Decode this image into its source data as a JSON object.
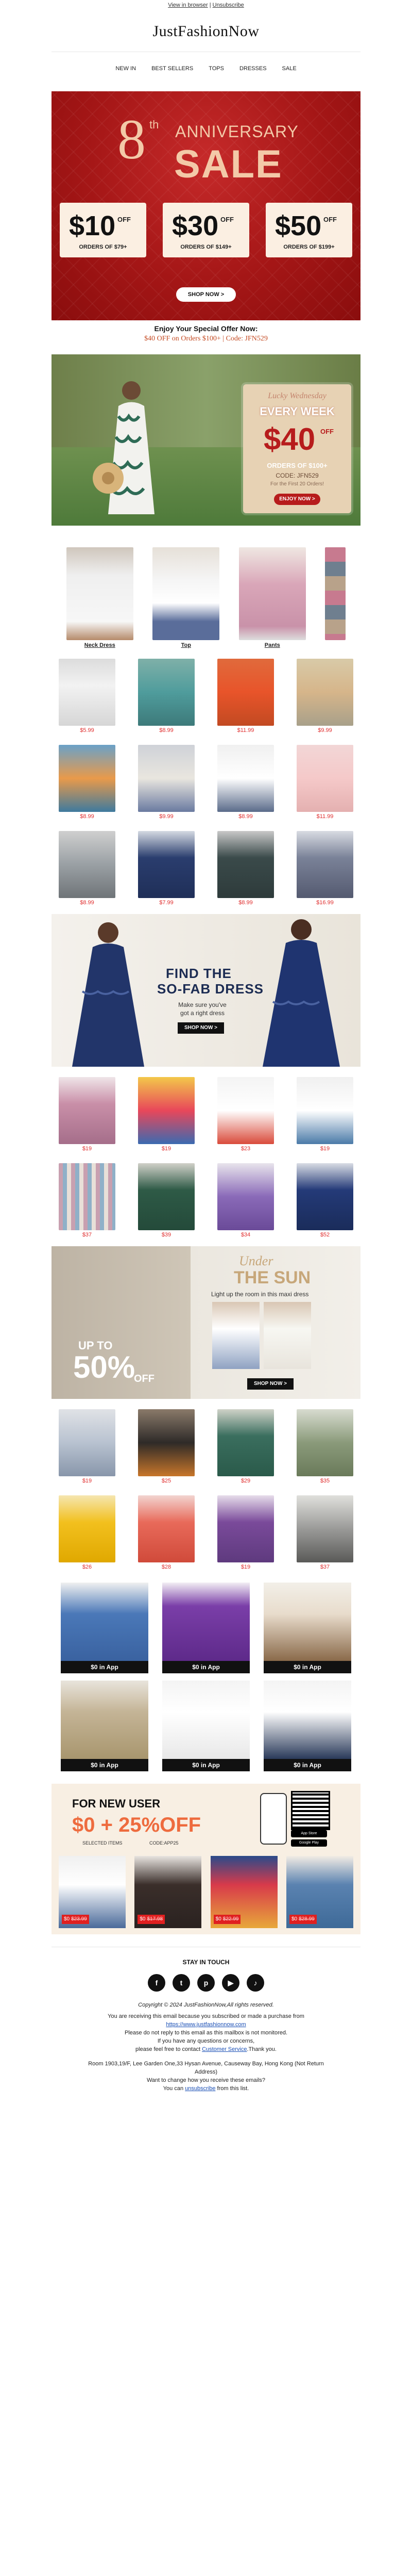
{
  "header": {
    "view_in_browser": "View in browser",
    "sep": " | ",
    "unsubscribe": "Unsubscribe",
    "brand": "JustFashionNow"
  },
  "nav": [
    "NEW IN",
    "BEST SELLERS",
    "TOPS",
    "DRESSES",
    "SALE"
  ],
  "hero": {
    "number": "8",
    "sup": "th",
    "anniversary": "ANNIVERSARY",
    "sale": "SALE",
    "tickets": [
      {
        "amount": "$10",
        "off": "OFF",
        "orders": "ORDERS OF $79+"
      },
      {
        "amount": "$30",
        "off": "OFF",
        "orders": "ORDERS OF $149+"
      },
      {
        "amount": "$50",
        "off": "OFF",
        "orders": "ORDERS OF $199+"
      }
    ],
    "shop_now": "SHOP NOW >",
    "colors": {
      "bg": "#a41616",
      "text": "#f3c9a8"
    }
  },
  "offer": {
    "line1": "Enjoy Your Special Offer Now:",
    "line2": "$40 OFF on Orders $100+ | Code: JFN529"
  },
  "promo": {
    "lucky": "Lucky Wednesday",
    "every_week": "EVERY WEEK",
    "amount": "$40",
    "off": "OFF",
    "orders": "ORDERS OF $100+",
    "code": "CODE: JFN529",
    "first": "For the First 20 Orders!",
    "button": "ENJOY NOW >"
  },
  "categories": [
    {
      "label": "Neck Dress"
    },
    {
      "label": "Top"
    },
    {
      "label": "Pants"
    }
  ],
  "products_a": [
    {
      "price": "$5.99"
    },
    {
      "price": "$8.99"
    },
    {
      "price": "$11.99"
    },
    {
      "price": "$9.99"
    },
    {
      "price": "$8.99"
    },
    {
      "price": "$9.99"
    },
    {
      "price": "$8.99"
    },
    {
      "price": "$11.99"
    },
    {
      "price": "$8.99"
    },
    {
      "price": "$7.99"
    },
    {
      "price": "$8.99"
    },
    {
      "price": "$16.99"
    }
  ],
  "banner1": {
    "line1": "FIND THE",
    "line2": "SO-FAB DRESS",
    "sub": "Make sure you've got a right dress",
    "button": "SHOP NOW >"
  },
  "products_b": [
    {
      "price": "$19"
    },
    {
      "price": "$19"
    },
    {
      "price": "$23"
    },
    {
      "price": "$19"
    },
    {
      "price": "$37"
    },
    {
      "price": "$39"
    },
    {
      "price": "$34"
    },
    {
      "price": "$52"
    }
  ],
  "banner2": {
    "under": "Under",
    "sun": "THE SUN",
    "sub": "Light up the room in this maxi dress",
    "upto": "UP TO",
    "fifty": "50%",
    "off": "OFF",
    "button": "SHOP NOW >"
  },
  "products_c": [
    {
      "price": "$19"
    },
    {
      "price": "$25"
    },
    {
      "price": "$29"
    },
    {
      "price": "$35"
    },
    {
      "price": "$26"
    },
    {
      "price": "$28"
    },
    {
      "price": "$19"
    },
    {
      "price": "$37"
    }
  ],
  "app_items": [
    {
      "label": "$0 in App"
    },
    {
      "label": "$0 in App"
    },
    {
      "label": "$0 in App"
    },
    {
      "label": "$0 in App"
    },
    {
      "label": "$0 in App"
    },
    {
      "label": "$0 in App"
    }
  ],
  "new_user": {
    "title": "FOR NEW USER",
    "deal": "$0 + 25%OFF",
    "selected": "SELECTED ITEMS",
    "code": "CODE:APP25",
    "app_store": "App Store",
    "google_play": "Google Play",
    "items": [
      {
        "now": "$0",
        "was": "$23.99"
      },
      {
        "now": "$0",
        "was": "$17.98"
      },
      {
        "now": "$0",
        "was": "$22.99"
      },
      {
        "now": "$0",
        "was": "$28.99"
      }
    ]
  },
  "footer": {
    "stay": "STAY IN TOUCH",
    "social": [
      "f",
      "t",
      "p",
      "▶",
      "♪"
    ],
    "copyright": "Copyright © 2024 JustFashionNow,All rights reserved.",
    "l1": "You are receiving this email because you subscribed or made a purchase from",
    "site": "https://www.justfashionnow.com",
    "l2": "Please do not reply to this email as this mailbox is not monitored.",
    "l3": "If you have any questions or concerns,",
    "l4a": "please feel free to contact ",
    "service": "Customer Service",
    "l4b": ".Thank you.",
    "address": "Room 1903,19/F, Lee Garden One,33 Hysan Avenue, Causeway Bay, Hong Kong (Not Return Address)",
    "l5": "Want to change how you receive these emails?",
    "l6a": "You can ",
    "unsub": "unsubscribe",
    "l6b": " from this list."
  }
}
